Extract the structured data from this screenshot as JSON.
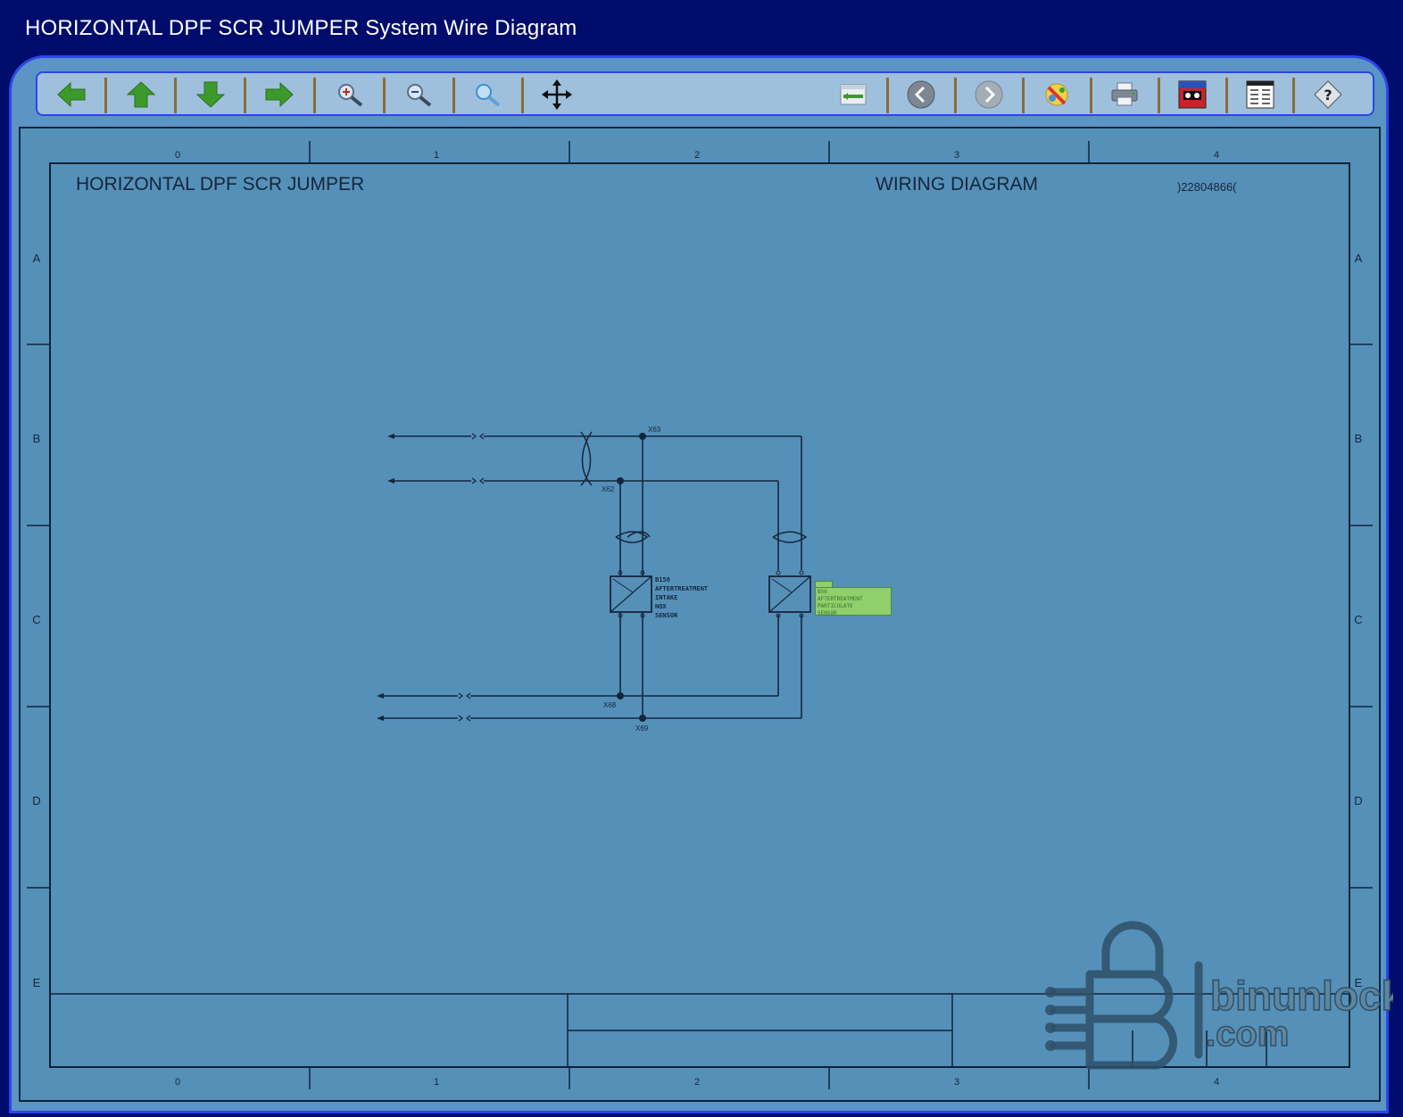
{
  "window": {
    "title": "HORIZONTAL DPF SCR JUMPER System Wire Diagram"
  },
  "toolbar": {
    "left_buttons": [
      "arrow-left-icon",
      "arrow-up-icon",
      "arrow-down-icon",
      "arrow-right-icon",
      "zoom-in-icon",
      "zoom-out-icon",
      "zoom-fit-icon",
      "pan-move-icon"
    ],
    "right_buttons": [
      "connector-view-icon",
      "previous-icon",
      "next-icon",
      "highlight-icon",
      "print-icon",
      "component-view-icon",
      "list-view-icon",
      "help-icon"
    ]
  },
  "drawing": {
    "title_left": "HORIZONTAL DPF SCR JUMPER",
    "title_center": "WIRING DIAGRAM",
    "document_id": ")22804866(",
    "column_labels": [
      "0",
      "1",
      "2",
      "3",
      "4"
    ],
    "row_labels": [
      "A",
      "B",
      "C",
      "D",
      "E"
    ]
  },
  "schematic": {
    "splices": [
      "X63",
      "X62",
      "X68",
      "X69"
    ],
    "component_left_lines": [
      "B158",
      "AFTERTREATMENT",
      "INTAKE",
      "NOX",
      "SENSOR"
    ],
    "component_right_lines": [
      "B56",
      "AFTERTREATMENT",
      "PARTICULATE",
      "SENSOR"
    ]
  },
  "watermark": {
    "brand": "binunlock",
    "domain": ".com"
  }
}
